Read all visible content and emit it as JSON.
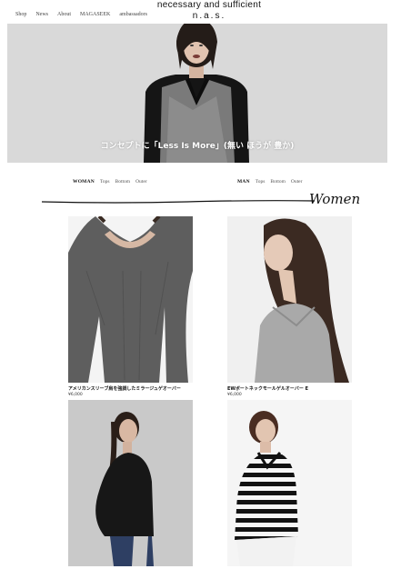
{
  "header": {
    "nav": [
      "Shop",
      "News",
      "About",
      "MAGASEEK",
      "ambassadors"
    ],
    "brand_line1": "necessary and sufficient",
    "brand_line2": "n.a.s."
  },
  "hero": {
    "caption": "コンセプトに「Less Is More」(無い ほうが 豊か)"
  },
  "category_nav": {
    "left": {
      "main": "WOMAN",
      "items": [
        "Tops",
        "Bottom",
        "Outer"
      ]
    },
    "right": {
      "main": "MAN",
      "items": [
        "Tops",
        "Bottom",
        "Outer"
      ]
    }
  },
  "section": {
    "title": "Women"
  },
  "products": [
    {
      "title": "アメリカンスリーブ肩を強調したミラージュゲオーバー",
      "price": "¥6,000"
    },
    {
      "title": "EWボートネックモールゲルオーバー E",
      "price": "¥6,000"
    },
    {
      "title": "",
      "price": ""
    },
    {
      "title": "",
      "price": ""
    }
  ],
  "colors": {
    "hero_bg": "#d9d9d9",
    "text": "#111111",
    "sweater_gray": "#5e5e5e"
  }
}
